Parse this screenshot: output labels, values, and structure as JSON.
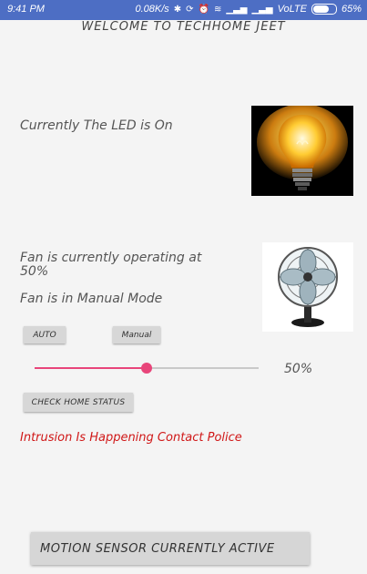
{
  "status_bar": {
    "time": "9:41 PM",
    "network_speed": "0.08K/s",
    "network_type": "VoLTE",
    "battery_percent": "65%",
    "battery_level": 0.65
  },
  "app": {
    "title": "WELCOME TO TECHHOME JEET"
  },
  "led": {
    "status_text": "Currently The LED is On",
    "icon": "lightbulb-icon"
  },
  "fan": {
    "status_text": "Fan is currently operating at 50%",
    "mode_text": "Fan is in Manual Mode",
    "icon": "fan-icon"
  },
  "controls": {
    "auto_label": "AUTO",
    "manual_label": "Manual",
    "check_label": "CHECK HOME STATUS"
  },
  "slider": {
    "value_label": "50%",
    "value": 0.5,
    "accent": "#e8457a"
  },
  "alerts": {
    "intrusion_text": "Intrusion Is Happening Contact Police",
    "color": "#d01818"
  },
  "motion": {
    "label": "MOTION SENSOR CURRENTLY ACTIVE"
  }
}
